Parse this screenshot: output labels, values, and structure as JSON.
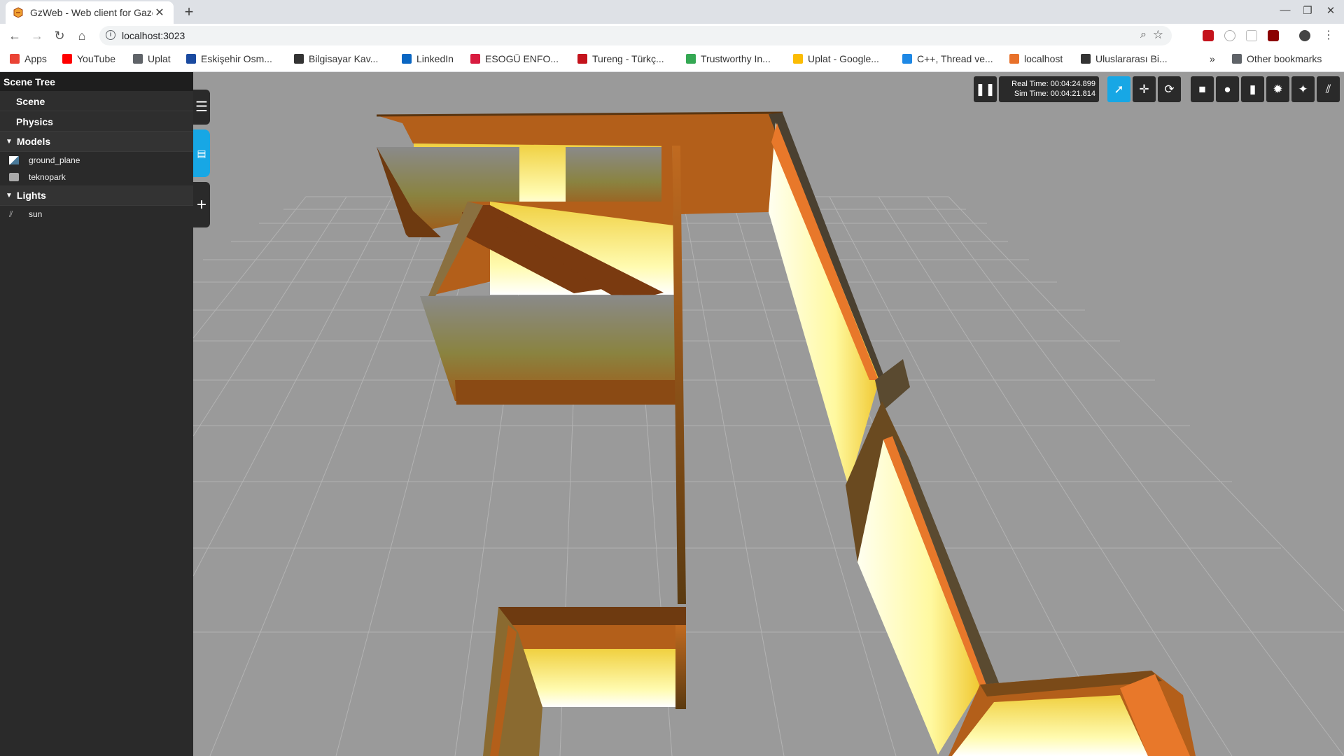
{
  "browser": {
    "tab_title": "GzWeb - Web client for Gazebo",
    "url": "localhost:3023",
    "bookmarks": [
      {
        "label": "Apps",
        "color": "#ea4335"
      },
      {
        "label": "YouTube",
        "color": "#ff0000"
      },
      {
        "label": "Uplat",
        "color": "#5f6368"
      },
      {
        "label": "Eskişehir Osm...",
        "color": "#1a4aa0"
      },
      {
        "label": "Bilgisayar Kav...",
        "color": "#333333"
      },
      {
        "label": "LinkedIn",
        "color": "#0a66c2"
      },
      {
        "label": "ESOGÜ ENFO...",
        "color": "#d81b3f"
      },
      {
        "label": "Tureng - Türkç...",
        "color": "#c4131c"
      },
      {
        "label": "Trustworthy In...",
        "color": "#34a853"
      },
      {
        "label": "Uplat - Google...",
        "color": "#fbbc04"
      },
      {
        "label": "C++, Thread ve...",
        "color": "#1e88e5"
      },
      {
        "label": "localhost",
        "color": "#e8712a"
      },
      {
        "label": "Uluslararası Bi...",
        "color": "#333333"
      }
    ],
    "more_chevron": "»",
    "other_bookmarks": "Other bookmarks"
  },
  "scene_tree": {
    "title": "Scene Tree",
    "sections": [
      "Scene",
      "Physics"
    ],
    "models_label": "Models",
    "models": [
      "ground_plane",
      "teknopark"
    ],
    "lights_label": "Lights",
    "lights": [
      "sun"
    ]
  },
  "hud": {
    "real_time": "Real Time: 00:04:24.899",
    "sim_time": "Sim Time: 00:04:21.814"
  },
  "colors": {
    "accent": "#17a7e5",
    "panel": "#2a2a2a",
    "ground": "#9a9a9a",
    "wall_top": "#e8782a",
    "wall_light": "#fffbb0"
  }
}
